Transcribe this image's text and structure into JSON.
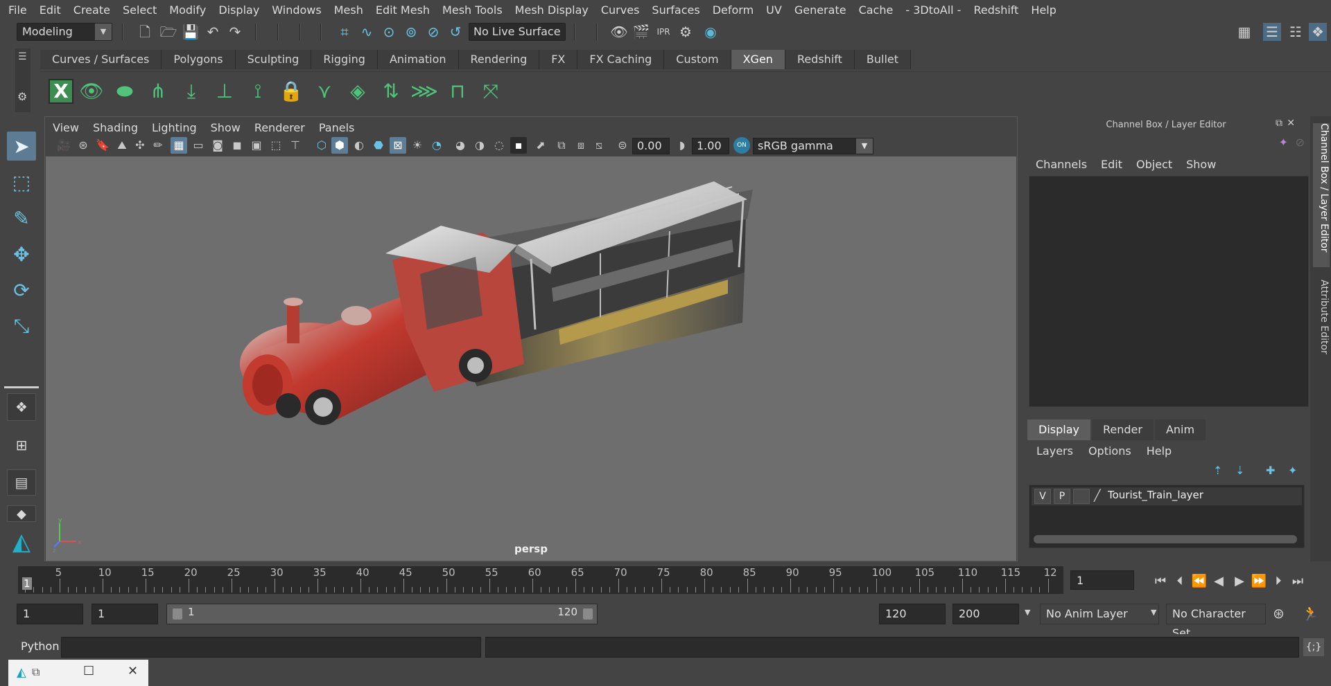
{
  "menubar": [
    "File",
    "Edit",
    "Create",
    "Select",
    "Modify",
    "Display",
    "Windows",
    "Mesh",
    "Edit Mesh",
    "Mesh Tools",
    "Mesh Display",
    "Curves",
    "Surfaces",
    "Deform",
    "UV",
    "Generate",
    "Cache",
    "- 3DtoAll -",
    "Redshift",
    "Help"
  ],
  "statusline": {
    "mode": "Modeling",
    "live_surface": "No Live Surface"
  },
  "shelf": {
    "tabs": [
      "Curves / Surfaces",
      "Polygons",
      "Sculpting",
      "Rigging",
      "Animation",
      "Rendering",
      "FX",
      "FX Caching",
      "Custom",
      "XGen",
      "Redshift",
      "Bullet"
    ],
    "active_tab": "XGen"
  },
  "viewport": {
    "menu": [
      "View",
      "Shading",
      "Lighting",
      "Show",
      "Renderer",
      "Panels"
    ],
    "exposure": "0.00",
    "gamma": "1.00",
    "color_space": "sRGB gamma",
    "camera_label": "persp"
  },
  "right_panel": {
    "title": "Channel Box / Layer Editor",
    "channel_menu": [
      "Channels",
      "Edit",
      "Object",
      "Show"
    ],
    "tabs": [
      "Display",
      "Render",
      "Anim"
    ],
    "layer_menu": [
      "Layers",
      "Options",
      "Help"
    ],
    "layer": {
      "v": "V",
      "p": "P",
      "name": "Tourist_Train_layer"
    },
    "vertical_tabs": [
      "Channel Box / Layer Editor",
      "Attribute Editor"
    ]
  },
  "timeline": {
    "labels": [
      "5",
      "10",
      "15",
      "20",
      "25",
      "30",
      "35",
      "40",
      "45",
      "50",
      "55",
      "60",
      "65",
      "70",
      "75",
      "80",
      "85",
      "90",
      "95",
      "100",
      "105",
      "110",
      "115",
      "12"
    ],
    "current": "1",
    "current_frame_field": "1"
  },
  "range": {
    "start": "1",
    "playback_start": "1",
    "slider_start": "1",
    "slider_end": "120",
    "playback_end": "120",
    "end": "200",
    "anim_layer": "No Anim Layer",
    "character_set": "No Character Set"
  },
  "cmdline": {
    "language": "Python"
  },
  "colors": {
    "accent": "#5d7b92",
    "shelf_green": "#4fc47a",
    "bg": "#444444"
  }
}
